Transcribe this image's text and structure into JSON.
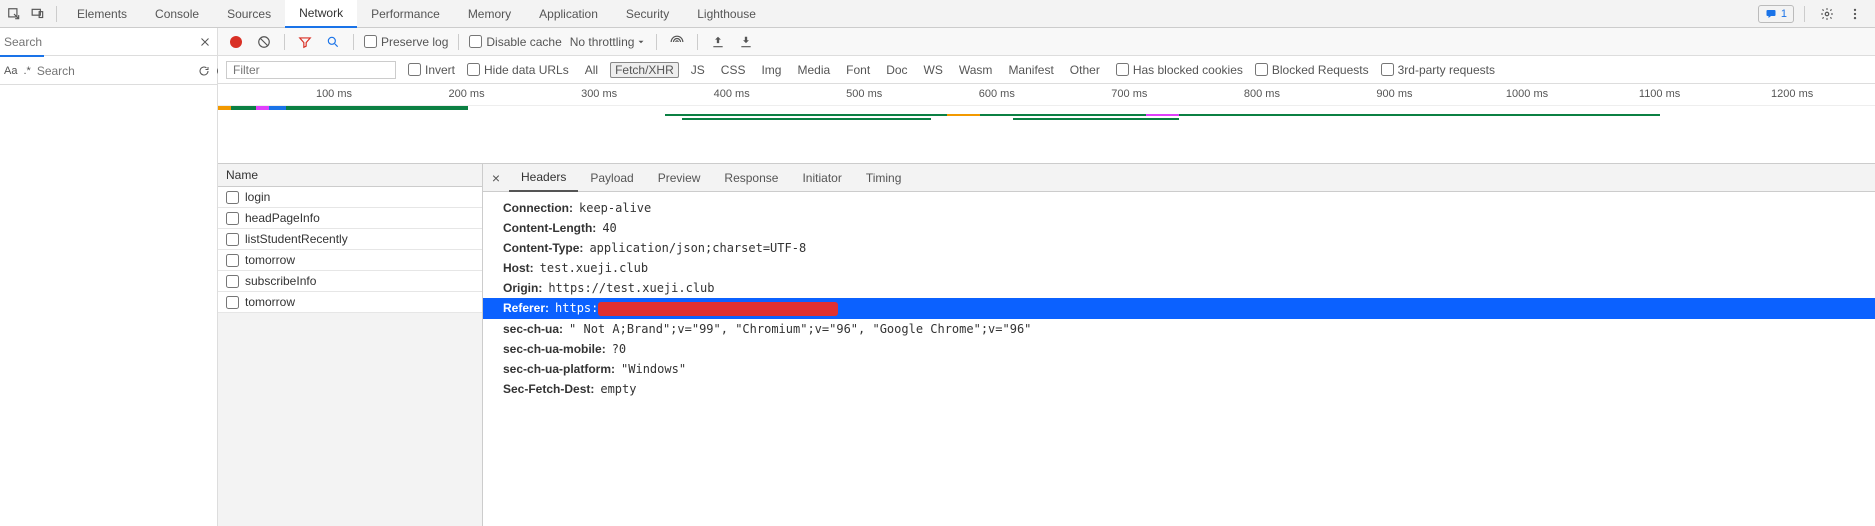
{
  "topTabs": [
    "Elements",
    "Console",
    "Sources",
    "Network",
    "Performance",
    "Memory",
    "Application",
    "Security",
    "Lighthouse"
  ],
  "topActiveIndex": 3,
  "badgeCount": "1",
  "leftSearch1Placeholder": "Search",
  "leftSearch2Placeholder": "Search",
  "leftMode1": "Aa",
  "leftMode2": ".*",
  "toolbar": {
    "preserveLog": "Preserve log",
    "disableCache": "Disable cache",
    "throttling": "No throttling"
  },
  "filter": {
    "placeholder": "Filter",
    "invert": "Invert",
    "hideData": "Hide data URLs",
    "chips": [
      "All",
      "Fetch/XHR",
      "JS",
      "CSS",
      "Img",
      "Media",
      "Font",
      "Doc",
      "WS",
      "Wasm",
      "Manifest",
      "Other"
    ],
    "activeChipIndex": 1,
    "hasBlocked": "Has blocked cookies",
    "blockedReq": "Blocked Requests",
    "thirdParty": "3rd-party requests"
  },
  "timelineTicks": [
    "100 ms",
    "200 ms",
    "300 ms",
    "400 ms",
    "500 ms",
    "600 ms",
    "700 ms",
    "800 ms",
    "900 ms",
    "1000 ms",
    "1100 ms",
    "1200 ms"
  ],
  "nameHeader": "Name",
  "requests": [
    "login",
    "headPageInfo",
    "listStudentRecently",
    "tomorrow",
    "subscribeInfo",
    "tomorrow"
  ],
  "detailTabs": [
    "Headers",
    "Payload",
    "Preview",
    "Response",
    "Initiator",
    "Timing"
  ],
  "detailActiveIndex": 0,
  "headers": {
    "connection": {
      "k": "Connection:",
      "v": "keep-alive"
    },
    "contentLength": {
      "k": "Content-Length:",
      "v": "40"
    },
    "contentType": {
      "k": "Content-Type:",
      "v": "application/json;charset=UTF-8"
    },
    "host": {
      "k": "Host:",
      "v": "test.xueji.club"
    },
    "origin": {
      "k": "Origin:",
      "v": "https://test.xueji.club"
    },
    "referer": {
      "k": "Referer:",
      "v": "https:"
    },
    "secChUa": {
      "k": "sec-ch-ua:",
      "v": "\" Not A;Brand\";v=\"99\", \"Chromium\";v=\"96\", \"Google Chrome\";v=\"96\""
    },
    "secChUaMobile": {
      "k": "sec-ch-ua-mobile:",
      "v": "?0"
    },
    "secChUaPlatform": {
      "k": "sec-ch-ua-platform:",
      "v": "\"Windows\""
    },
    "secFetchDest": {
      "k": "Sec-Fetch-Dest:",
      "v": "empty"
    }
  }
}
